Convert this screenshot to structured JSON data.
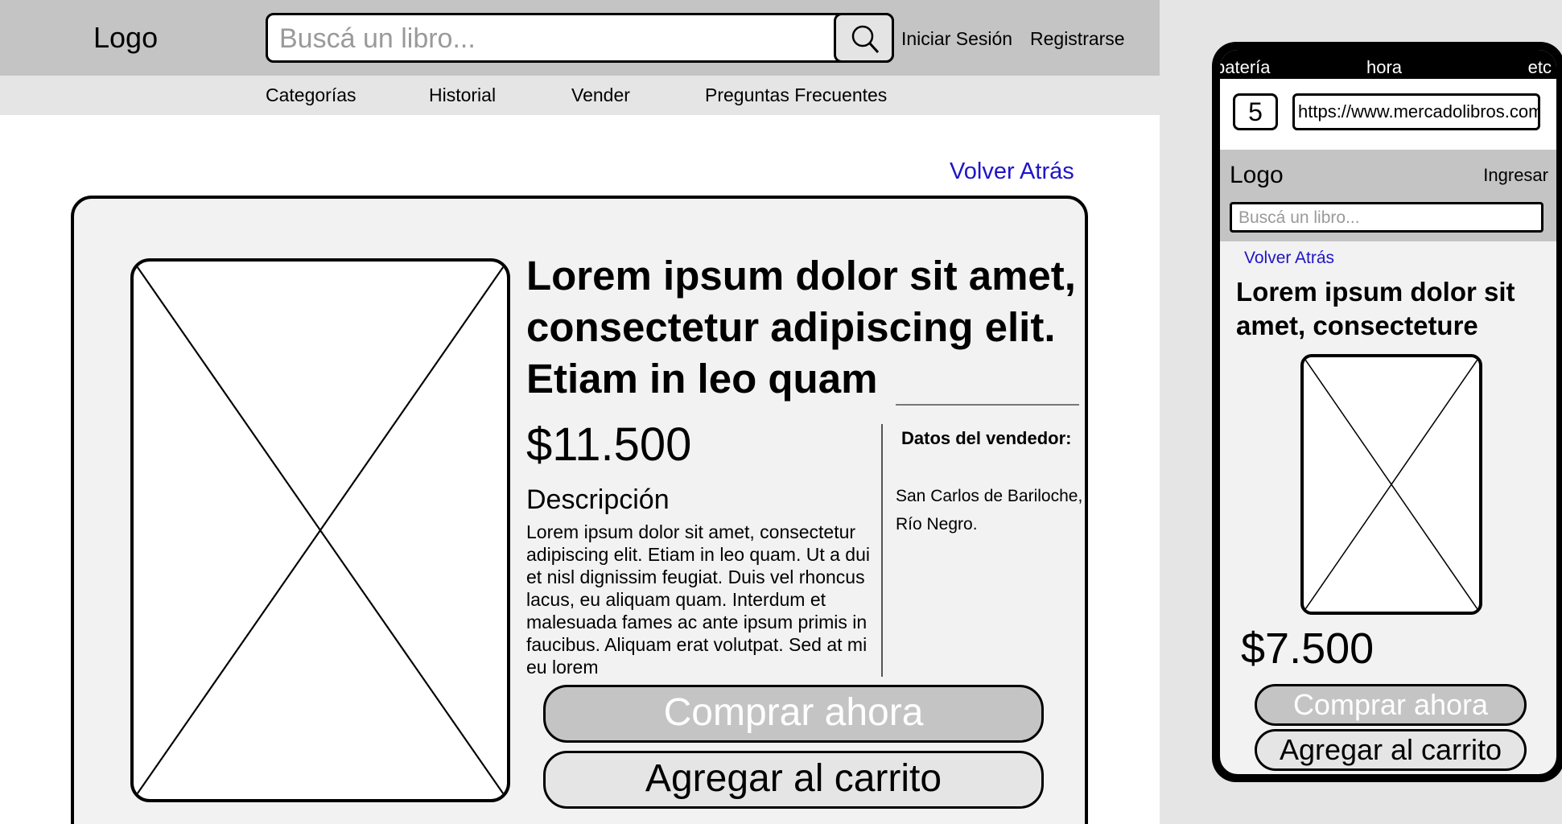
{
  "desktop": {
    "header": {
      "logo": "Logo",
      "search_placeholder": "Buscá un libro...",
      "login": "Iniciar Sesión",
      "register": "Registrarse"
    },
    "nav": [
      "Categorías",
      "Historial",
      "Vender",
      "Preguntas Frecuentes"
    ],
    "back_link": "Volver Atrás",
    "product": {
      "title": "Lorem ipsum dolor sit amet, consectetur adipiscing elit. Etiam in leo quam",
      "price": "$11.500",
      "description_label": "Descripción",
      "description": "Lorem ipsum dolor sit amet, consectetur adipiscing elit. Etiam in leo quam. Ut a dui et nisl dignissim feugiat. Duis vel rhoncus lacus, eu aliquam quam. Interdum et malesuada fames ac ante ipsum primis in faucibus. Aliquam erat volutpat. Sed at mi eu lorem",
      "seller_label": "Datos del vendedor:",
      "seller_location": "San Carlos de Bariloche, Río Negro.",
      "buy_now": "Comprar ahora",
      "add_to_cart": "Agregar al carrito"
    }
  },
  "mobile": {
    "status": {
      "left": "batería",
      "center": "hora",
      "right": "etc"
    },
    "browser": {
      "tabs_count": "5",
      "url": "https://www.mercadolibros.com"
    },
    "header": {
      "logo": "Logo",
      "login": "Ingresar",
      "search_placeholder": "Buscá un libro..."
    },
    "back_link": "Volver Atrás",
    "product": {
      "title": "Lorem ipsum dolor sit amet, consecteture",
      "price": "$7.500",
      "buy_now": "Comprar ahora",
      "add_to_cart": "Agregar al carrito"
    }
  },
  "colors": {
    "header_bg": "#c4c4c4",
    "nav_bg": "#e5e5e5",
    "card_bg": "#f2f2f2",
    "link": "#1f14c8",
    "buy_button": "#c4c4c4",
    "cart_button": "#e5e5e5"
  }
}
